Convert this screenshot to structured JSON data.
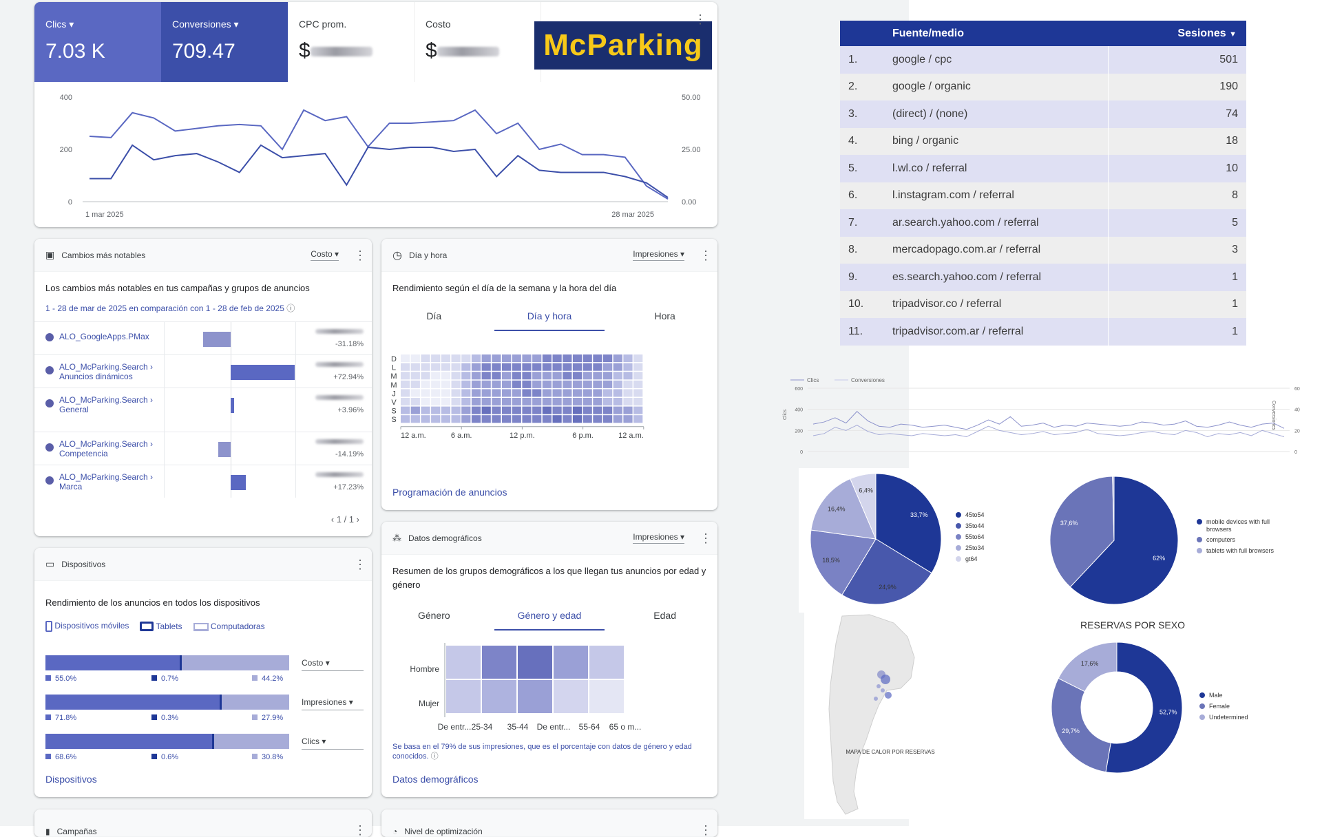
{
  "metrics": {
    "clicks_label": "Clics",
    "clicks_value": "7.03 K",
    "conv_label": "Conversiones",
    "conv_value": "709.47",
    "cpc_label": "CPC prom.",
    "cost_label": "Costo",
    "currency": "$"
  },
  "logo": {
    "text": "McParking",
    "bg": "#1a2e6e",
    "fg": "#f7c919"
  },
  "trend": {
    "y_left_ticks": [
      "400",
      "200",
      "0"
    ],
    "y_right_ticks": [
      "50.00",
      "25.00",
      "0.00"
    ],
    "x_start": "1 mar 2025",
    "x_end": "28 mar 2025",
    "clicks": [
      250,
      245,
      340,
      320,
      270,
      280,
      290,
      295,
      290,
      200,
      350,
      310,
      325,
      210,
      300,
      300,
      305,
      310,
      350,
      260,
      300,
      200,
      220,
      180,
      180,
      170,
      60,
      10
    ],
    "conversions": [
      11,
      11,
      27,
      20,
      22,
      23,
      19,
      14,
      27,
      21,
      22,
      23,
      8,
      26,
      25,
      26,
      26,
      24,
      25,
      12,
      22,
      15,
      14,
      14,
      14,
      12,
      9,
      2
    ]
  },
  "changes": {
    "title": "Cambios más notables",
    "dropdown": "Costo",
    "subtitle": "Los cambios más notables en tus campañas y grupos de anuncios",
    "period": "1 - 28 de mar de 2025 en comparación con 1 - 28 de feb de 2025",
    "pager": "1 / 1",
    "rows": [
      {
        "l1": "ALO_GoogleApps.PMax",
        "l2": "",
        "pct": "-31.18%",
        "v": -31.18
      },
      {
        "l1": "ALO_McParking.Search ›",
        "l2": "Anuncios dinámicos",
        "pct": "+72.94%",
        "v": 72.94
      },
      {
        "l1": "ALO_McParking.Search ›",
        "l2": "General",
        "pct": "+3.96%",
        "v": 3.96
      },
      {
        "l1": "ALO_McParking.Search ›",
        "l2": "Competencia",
        "pct": "-14.19%",
        "v": -14.19
      },
      {
        "l1": "ALO_McParking.Search ›",
        "l2": "Marca",
        "pct": "+17.23%",
        "v": 17.23
      }
    ]
  },
  "dayhour": {
    "title": "Día y hora",
    "dropdown": "Impresiones",
    "subtitle": "Rendimiento según el día de la semana y la hora del día",
    "tabs": [
      "Día",
      "Día y hora",
      "Hora"
    ],
    "days": [
      "D",
      "L",
      "M",
      "M",
      "J",
      "V",
      "S",
      "S"
    ],
    "hours": [
      "12 a.m.",
      "6 a.m.",
      "12 p.m.",
      "6 p.m.",
      "12 a.m."
    ],
    "link": "Programación de anuncios"
  },
  "devices": {
    "title": "Dispositivos",
    "subtitle": "Rendimiento de los anuncios en todos los dispositivos",
    "legend": [
      "Dispositivos móviles",
      "Tablets",
      "Computadoras"
    ],
    "link": "Dispositivos",
    "rows": [
      {
        "metric": "Costo",
        "vals": [
          55.0,
          0.7,
          44.2
        ],
        "labels": [
          "55.0%",
          "0.7%",
          "44.2%"
        ]
      },
      {
        "metric": "Impresiones",
        "vals": [
          71.8,
          0.3,
          27.9
        ],
        "labels": [
          "71.8%",
          "0.3%",
          "27.9%"
        ]
      },
      {
        "metric": "Clics",
        "vals": [
          68.6,
          0.6,
          30.8
        ],
        "labels": [
          "68.6%",
          "0.6%",
          "30.8%"
        ]
      }
    ]
  },
  "demo": {
    "title": "Datos demográficos",
    "dropdown": "Impresiones",
    "subtitle": "Resumen de los grupos demográficos a los que llegan tus anuncios por edad y género",
    "tabs": [
      "Género",
      "Género y edad",
      "Edad"
    ],
    "rows": [
      "Hombre",
      "Mujer"
    ],
    "cols": [
      "De entr...",
      "25-34",
      "35-44",
      "De entr...",
      "55-64",
      "65 o m..."
    ],
    "note": "Se basa en el 79% de sus impresiones, que es el porcentaje con datos de género y edad conocidos.",
    "link": "Datos demográficos"
  },
  "bottom_cards": [
    "Campañas",
    "Nivel de optimización"
  ],
  "sources": {
    "col1": "Fuente/medio",
    "col2": "Sesiones",
    "rows": [
      [
        "1.",
        "google / cpc",
        "501"
      ],
      [
        "2.",
        "google / organic",
        "190"
      ],
      [
        "3.",
        "(direct) / (none)",
        "74"
      ],
      [
        "4.",
        "bing / organic",
        "18"
      ],
      [
        "5.",
        "l.wl.co / referral",
        "10"
      ],
      [
        "6.",
        "l.instagram.com / referral",
        "8"
      ],
      [
        "7.",
        "ar.search.yahoo.com / referral",
        "5"
      ],
      [
        "8.",
        "mercadopago.com.ar / referral",
        "3"
      ],
      [
        "9.",
        "es.search.yahoo.com / referral",
        "1"
      ],
      [
        "10.",
        "tripadvisor.co / referral",
        "1"
      ],
      [
        "11.",
        "tripadvisor.com.ar / referral",
        "1"
      ]
    ]
  },
  "mini": {
    "legend": [
      "Clics",
      "Conversiones"
    ],
    "y_left": [
      "600",
      "400",
      "200",
      "0"
    ],
    "y_right": [
      "60",
      "40",
      "20",
      "0"
    ],
    "y_left_label": "Clics",
    "y_right_label": "Conversiones"
  },
  "pie_age": {
    "slices": [
      {
        "label": "45to54",
        "pct": "33,7%",
        "v": 33.7,
        "color": "#1e3796"
      },
      {
        "label": "35to44",
        "pct": "24,9%",
        "v": 24.9,
        "color": "#4858ac"
      },
      {
        "label": "55to64",
        "pct": "18,5%",
        "v": 18.5,
        "color": "#7a82c4"
      },
      {
        "label": "25to34",
        "pct": "16,4%",
        "v": 16.4,
        "color": "#a7acd8"
      },
      {
        "label": "gt64",
        "pct": "6,4%",
        "v": 6.4,
        "color": "#d3d5ec"
      }
    ]
  },
  "pie_device": {
    "slices": [
      {
        "label": "mobile devices with full browsers",
        "pct": "62%",
        "v": 62,
        "color": "#1e3796"
      },
      {
        "label": "computers",
        "pct": "37,6%",
        "v": 37.6,
        "color": "#6a74b8"
      },
      {
        "label": "tablets with full browsers",
        "pct": "",
        "v": 0.4,
        "color": "#a7acd8"
      }
    ]
  },
  "donut_sex": {
    "title": "RESERVAS POR SEXO",
    "slices": [
      {
        "label": "Male",
        "pct": "52,7%",
        "v": 52.7,
        "color": "#1e3796"
      },
      {
        "label": "Female",
        "pct": "29,7%",
        "v": 29.7,
        "color": "#6a74b8"
      },
      {
        "label": "Undetermined",
        "pct": "17,6%",
        "v": 17.6,
        "color": "#a7acd8"
      }
    ]
  },
  "map": {
    "caption": "MAPA DE CALOR POR RESERVAS"
  }
}
